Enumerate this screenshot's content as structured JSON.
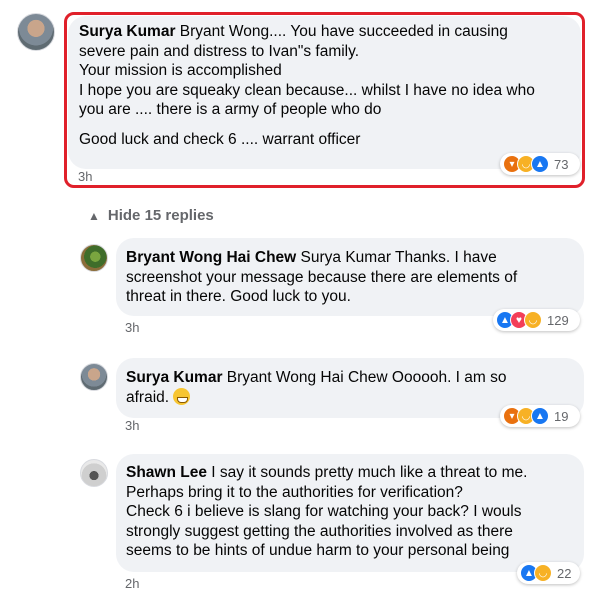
{
  "comments": [
    {
      "author": "Surya Kumar",
      "lines": [
        "Bryant Wong.... You have succeeded in causing",
        "severe pain and distress to Ivan\"s family.",
        "Your mission is accomplished",
        "I hope you are squeaky clean because... whilst I have no idea who",
        "you are .... there is a army of people who do",
        "Good luck and check 6 .... warrant officer"
      ],
      "time": "3h",
      "reactions": [
        "angry",
        "haha",
        "like"
      ],
      "reaction_count": "73"
    }
  ],
  "hide_replies": "Hide 15 replies",
  "replies": [
    {
      "author": "Bryant Wong Hai Chew",
      "lines": [
        "Surya Kumar Thanks. I have",
        "screenshot your message because there are elements of",
        "threat in there. Good luck to you."
      ],
      "time": "3h",
      "reactions": [
        "like",
        "love",
        "care"
      ],
      "reaction_count": "129"
    },
    {
      "author": "Surya Kumar",
      "lines": [
        "Bryant Wong Hai Chew Oooooh. I am so",
        "afraid."
      ],
      "time": "3h",
      "reactions": [
        "angry",
        "haha",
        "like"
      ],
      "reaction_count": "19"
    },
    {
      "author": "Shawn Lee",
      "lines": [
        "I say it sounds pretty much like a threat to me.",
        "Perhaps bring it to the authorities for verification?",
        "Check 6 i believe is slang for watching your back? I wouls",
        "strongly suggest getting the authorities involved as there",
        "seems to be hints of undue harm to your personal being"
      ],
      "time": "2h",
      "reactions": [
        "like",
        "haha"
      ],
      "reaction_count": "22"
    }
  ],
  "colors": {
    "highlight": "#e0202a",
    "bubble": "#f0f2f5",
    "like": "#1877f2",
    "angry": "#e9710f",
    "haha": "#f7b125",
    "love": "#f33e58"
  }
}
